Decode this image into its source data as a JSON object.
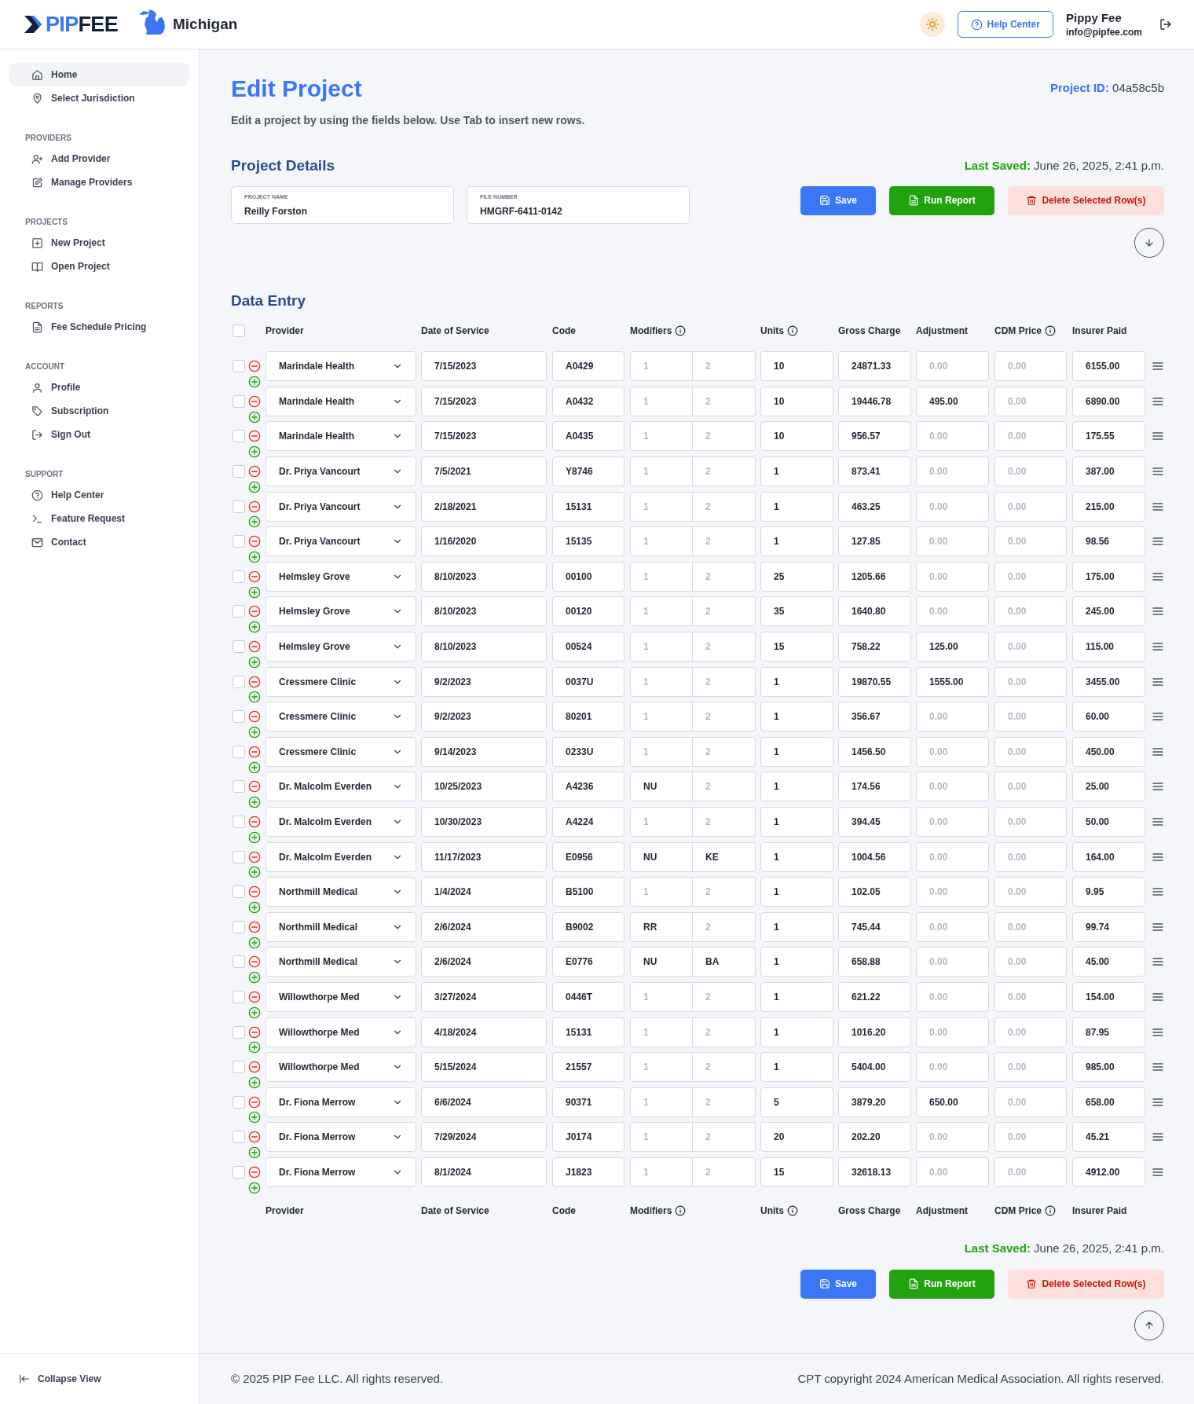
{
  "header": {
    "logo": [
      "PIP",
      "FEE"
    ],
    "jurisdiction": "Michigan",
    "help_button": "Help Center",
    "user_name": "Pippy Fee",
    "user_email": "info@pipfee.com"
  },
  "sidebar": {
    "sections": [
      {
        "items": [
          {
            "label": "Home",
            "selected": true
          },
          {
            "label": "Select Jurisdiction",
            "selected": false
          }
        ]
      },
      {
        "heading": "PROVIDERS",
        "items": [
          {
            "label": "Add Provider",
            "selected": false
          },
          {
            "label": "Manage Providers",
            "selected": false
          }
        ]
      },
      {
        "heading": "PROJECTS",
        "items": [
          {
            "label": "New Project",
            "selected": false
          },
          {
            "label": "Open Project",
            "selected": false
          }
        ]
      },
      {
        "heading": "REPORTS",
        "items": [
          {
            "label": "Fee Schedule Pricing",
            "selected": false
          }
        ]
      },
      {
        "heading": "ACCOUNT",
        "items": [
          {
            "label": "Profile",
            "selected": false
          },
          {
            "label": "Subscription",
            "selected": false
          },
          {
            "label": "Sign Out",
            "selected": false
          }
        ]
      },
      {
        "heading": "SUPPORT",
        "items": [
          {
            "label": "Help Center",
            "selected": false
          },
          {
            "label": "Feature Request",
            "selected": false
          },
          {
            "label": "Contact",
            "selected": false
          }
        ]
      }
    ],
    "collapse": "Collapse View"
  },
  "page": {
    "title": "Edit Project",
    "subtitle": "Edit a project by using the fields below. Use Tab to insert new rows.",
    "project_id_label": "Project ID:",
    "project_id": "04a58c5b",
    "details_heading": "Project Details",
    "last_saved_label": "Last Saved:",
    "last_saved": "June 26, 2025, 2:41 p.m.",
    "fields": [
      {
        "label": "PROJECT NAME",
        "value": "Reilly Forston"
      },
      {
        "label": "FILE NUMBER",
        "value": "HMGRF-6411-0142"
      }
    ],
    "buttons": [
      {
        "kind": "save",
        "label": "Save"
      },
      {
        "kind": "report",
        "label": "Run Report"
      },
      {
        "kind": "delete",
        "label": "Delete Selected Row(s)"
      }
    ],
    "data_heading": "Data Entry",
    "header_checkbox": {
      "checked": false
    },
    "columns": [
      {
        "label": "Provider"
      },
      {
        "label": "Date of Service"
      },
      {
        "label": "Code"
      },
      {
        "label": "Modifiers",
        "info": true
      },
      {
        "label": "Units",
        "info": true
      },
      {
        "label": "Gross Charge"
      },
      {
        "label": "Adjustment"
      },
      {
        "label": "CDM Price",
        "info": true
      },
      {
        "label": "Insurer Paid"
      }
    ],
    "rows": [
      {
        "selected": false,
        "provider": "Marindale Health",
        "date": "7/15/2023",
        "code": "A0429",
        "modifier_1": {
          "placeholder": "1"
        },
        "modifier_2": {
          "placeholder": "2"
        },
        "units": "10",
        "gross": "24871.33",
        "adjustment": {
          "placeholder": "0.00"
        },
        "cdm": {
          "placeholder": "0.00"
        },
        "paid": "6155.00"
      },
      {
        "selected": false,
        "provider": "Marindale Health",
        "date": "7/15/2023",
        "code": "A0432",
        "modifier_1": {
          "placeholder": "1"
        },
        "modifier_2": {
          "placeholder": "2"
        },
        "units": "10",
        "gross": "19446.78",
        "adjustment": {
          "value": "495.00"
        },
        "cdm": {
          "placeholder": "0.00"
        },
        "paid": "6890.00"
      },
      {
        "selected": false,
        "provider": "Marindale Health",
        "date": "7/15/2023",
        "code": "A0435",
        "modifier_1": {
          "placeholder": "1"
        },
        "modifier_2": {
          "placeholder": "2"
        },
        "units": "10",
        "gross": "956.57",
        "adjustment": {
          "placeholder": "0.00"
        },
        "cdm": {
          "placeholder": "0.00"
        },
        "paid": "175.55"
      },
      {
        "selected": false,
        "provider": "Dr. Priya Vancourt",
        "date": "7/5/2021",
        "code": "Y8746",
        "modifier_1": {
          "placeholder": "1"
        },
        "modifier_2": {
          "placeholder": "2"
        },
        "units": "1",
        "gross": "873.41",
        "adjustment": {
          "placeholder": "0.00"
        },
        "cdm": {
          "placeholder": "0.00"
        },
        "paid": "387.00"
      },
      {
        "selected": false,
        "provider": "Dr. Priya Vancourt",
        "date": "2/18/2021",
        "code": "15131",
        "modifier_1": {
          "placeholder": "1"
        },
        "modifier_2": {
          "placeholder": "2"
        },
        "units": "1",
        "gross": "463.25",
        "adjustment": {
          "placeholder": "0.00"
        },
        "cdm": {
          "placeholder": "0.00"
        },
        "paid": "215.00"
      },
      {
        "selected": false,
        "provider": "Dr. Priya Vancourt",
        "date": "1/16/2020",
        "code": "15135",
        "modifier_1": {
          "placeholder": "1"
        },
        "modifier_2": {
          "placeholder": "2"
        },
        "units": "1",
        "gross": "127.85",
        "adjustment": {
          "placeholder": "0.00"
        },
        "cdm": {
          "placeholder": "0.00"
        },
        "paid": "98.56"
      },
      {
        "selected": false,
        "provider": "Helmsley Grove",
        "date": "8/10/2023",
        "code": "00100",
        "modifier_1": {
          "placeholder": "1"
        },
        "modifier_2": {
          "placeholder": "2"
        },
        "units": "25",
        "gross": "1205.66",
        "adjustment": {
          "placeholder": "0.00"
        },
        "cdm": {
          "placeholder": "0.00"
        },
        "paid": "175.00"
      },
      {
        "selected": false,
        "provider": "Helmsley Grove",
        "date": "8/10/2023",
        "code": "00120",
        "modifier_1": {
          "placeholder": "1"
        },
        "modifier_2": {
          "placeholder": "2"
        },
        "units": "35",
        "gross": "1640.80",
        "adjustment": {
          "placeholder": "0.00"
        },
        "cdm": {
          "placeholder": "0.00"
        },
        "paid": "245.00"
      },
      {
        "selected": false,
        "provider": "Helmsley Grove",
        "date": "8/10/2023",
        "code": "00524",
        "modifier_1": {
          "placeholder": "1"
        },
        "modifier_2": {
          "placeholder": "2"
        },
        "units": "15",
        "gross": "758.22",
        "adjustment": {
          "value": "125.00"
        },
        "cdm": {
          "placeholder": "0.00"
        },
        "paid": "115.00"
      },
      {
        "selected": false,
        "provider": "Cressmere Clinic",
        "date": "9/2/2023",
        "code": "0037U",
        "modifier_1": {
          "placeholder": "1"
        },
        "modifier_2": {
          "placeholder": "2"
        },
        "units": "1",
        "gross": "19870.55",
        "adjustment": {
          "value": "1555.00"
        },
        "cdm": {
          "placeholder": "0.00"
        },
        "paid": "3455.00"
      },
      {
        "selected": false,
        "provider": "Cressmere Clinic",
        "date": "9/2/2023",
        "code": "80201",
        "modifier_1": {
          "placeholder": "1"
        },
        "modifier_2": {
          "placeholder": "2"
        },
        "units": "1",
        "gross": "356.67",
        "adjustment": {
          "placeholder": "0.00"
        },
        "cdm": {
          "placeholder": "0.00"
        },
        "paid": "60.00"
      },
      {
        "selected": false,
        "provider": "Cressmere Clinic",
        "date": "9/14/2023",
        "code": "0233U",
        "modifier_1": {
          "placeholder": "1"
        },
        "modifier_2": {
          "placeholder": "2"
        },
        "units": "1",
        "gross": "1456.50",
        "adjustment": {
          "placeholder": "0.00"
        },
        "cdm": {
          "placeholder": "0.00"
        },
        "paid": "450.00"
      },
      {
        "selected": false,
        "provider": "Dr. Malcolm Everden",
        "date": "10/25/2023",
        "code": "A4236",
        "modifier_1": {
          "value": "NU"
        },
        "modifier_2": {
          "placeholder": "2"
        },
        "units": "1",
        "gross": "174.56",
        "adjustment": {
          "placeholder": "0.00"
        },
        "cdm": {
          "placeholder": "0.00"
        },
        "paid": "25.00"
      },
      {
        "selected": false,
        "provider": "Dr. Malcolm Everden",
        "date": "10/30/2023",
        "code": "A4224",
        "modifier_1": {
          "placeholder": "1"
        },
        "modifier_2": {
          "placeholder": "2"
        },
        "units": "1",
        "gross": "394.45",
        "adjustment": {
          "placeholder": "0.00"
        },
        "cdm": {
          "placeholder": "0.00"
        },
        "paid": "50.00"
      },
      {
        "selected": false,
        "provider": "Dr. Malcolm Everden",
        "date": "11/17/2023",
        "code": "E0956",
        "modifier_1": {
          "value": "NU"
        },
        "modifier_2": {
          "value": "KE"
        },
        "units": "1",
        "gross": "1004.56",
        "adjustment": {
          "placeholder": "0.00"
        },
        "cdm": {
          "placeholder": "0.00"
        },
        "paid": "164.00"
      },
      {
        "selected": false,
        "provider": "Northmill Medical",
        "date": "1/4/2024",
        "code": "B5100",
        "modifier_1": {
          "placeholder": "1"
        },
        "modifier_2": {
          "placeholder": "2"
        },
        "units": "1",
        "gross": "102.05",
        "adjustment": {
          "placeholder": "0.00"
        },
        "cdm": {
          "placeholder": "0.00"
        },
        "paid": "9.95"
      },
      {
        "selected": false,
        "provider": "Northmill Medical",
        "date": "2/6/2024",
        "code": "B9002",
        "modifier_1": {
          "value": "RR"
        },
        "modifier_2": {
          "placeholder": "2"
        },
        "units": "1",
        "gross": "745.44",
        "adjustment": {
          "placeholder": "0.00"
        },
        "cdm": {
          "placeholder": "0.00"
        },
        "paid": "99.74"
      },
      {
        "selected": false,
        "provider": "Northmill Medical",
        "date": "2/6/2024",
        "code": "E0776",
        "modifier_1": {
          "value": "NU"
        },
        "modifier_2": {
          "value": "BA"
        },
        "units": "1",
        "gross": "658.88",
        "adjustment": {
          "placeholder": "0.00"
        },
        "cdm": {
          "placeholder": "0.00"
        },
        "paid": "45.00"
      },
      {
        "selected": false,
        "provider": "Willowthorpe Med",
        "date": "3/27/2024",
        "code": "0446T",
        "modifier_1": {
          "placeholder": "1"
        },
        "modifier_2": {
          "placeholder": "2"
        },
        "units": "1",
        "gross": "621.22",
        "adjustment": {
          "placeholder": "0.00"
        },
        "cdm": {
          "placeholder": "0.00"
        },
        "paid": "154.00"
      },
      {
        "selected": false,
        "provider": "Willowthorpe Med",
        "date": "4/18/2024",
        "code": "15131",
        "modifier_1": {
          "placeholder": "1"
        },
        "modifier_2": {
          "placeholder": "2"
        },
        "units": "1",
        "gross": "1016.20",
        "adjustment": {
          "placeholder": "0.00"
        },
        "cdm": {
          "placeholder": "0.00"
        },
        "paid": "87.95"
      },
      {
        "selected": false,
        "provider": "Willowthorpe Med",
        "date": "5/15/2024",
        "code": "21557",
        "modifier_1": {
          "placeholder": "1"
        },
        "modifier_2": {
          "placeholder": "2"
        },
        "units": "1",
        "gross": "5404.00",
        "adjustment": {
          "placeholder": "0.00"
        },
        "cdm": {
          "placeholder": "0.00"
        },
        "paid": "985.00"
      },
      {
        "selected": false,
        "provider": "Dr. Fiona Merrow",
        "date": "6/6/2024",
        "code": "90371",
        "modifier_1": {
          "placeholder": "1"
        },
        "modifier_2": {
          "placeholder": "2"
        },
        "units": "5",
        "gross": "3879.20",
        "adjustment": {
          "value": "650.00"
        },
        "cdm": {
          "placeholder": "0.00"
        },
        "paid": "658.00"
      },
      {
        "selected": false,
        "provider": "Dr. Fiona Merrow",
        "date": "7/29/2024",
        "code": "J0174",
        "modifier_1": {
          "placeholder": "1"
        },
        "modifier_2": {
          "placeholder": "2"
        },
        "units": "20",
        "gross": "202.20",
        "adjustment": {
          "placeholder": "0.00"
        },
        "cdm": {
          "placeholder": "0.00"
        },
        "paid": "45.21"
      },
      {
        "selected": false,
        "provider": "Dr. Fiona Merrow",
        "date": "8/1/2024",
        "code": "J1823",
        "modifier_1": {
          "placeholder": "1"
        },
        "modifier_2": {
          "placeholder": "2"
        },
        "units": "15",
        "gross": "32618.13",
        "adjustment": {
          "placeholder": "0.00"
        },
        "cdm": {
          "placeholder": "0.00"
        },
        "paid": "4912.00"
      }
    ],
    "footer_columns": [
      {
        "label": "Provider"
      },
      {
        "label": "Date of Service"
      },
      {
        "label": "Code"
      },
      {
        "label": "Modifiers",
        "info": true
      },
      {
        "label": "Units",
        "info": true
      },
      {
        "label": "Gross Charge"
      },
      {
        "label": "Adjustment"
      },
      {
        "label": "CDM Price",
        "info": true
      },
      {
        "label": "Insurer Paid"
      }
    ],
    "bottom_last_saved_label": "Last Saved:",
    "bottom_last_saved": "June 26, 2025, 2:41 p.m.",
    "bottom_buttons": [
      {
        "kind": "save",
        "label": "Save"
      },
      {
        "kind": "report",
        "label": "Run Report"
      },
      {
        "kind": "delete",
        "label": "Delete Selected Row(s)"
      }
    ]
  },
  "footer": {
    "copyright": "© 2025 PIP Fee LLC. All rights reserved.",
    "cpt_notice": "CPT copyright 2024 American Medical Association. All rights reserved."
  }
}
